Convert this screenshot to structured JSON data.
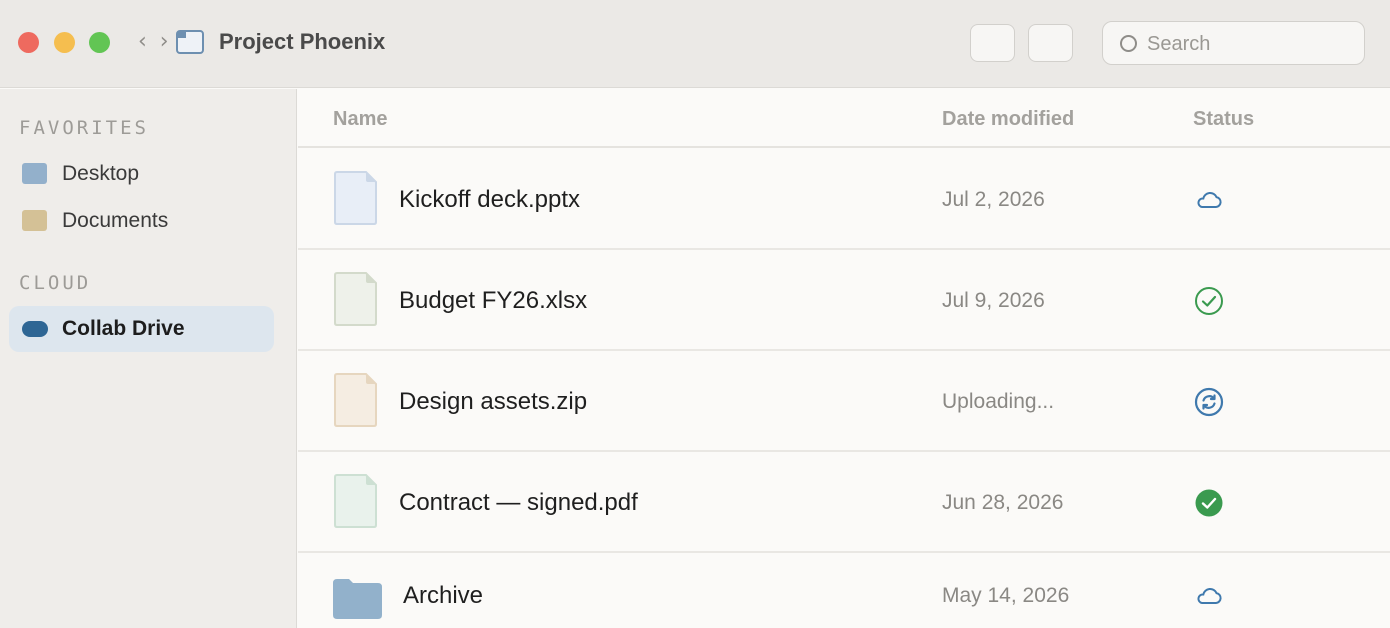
{
  "window": {
    "title": "Project Phoenix",
    "nav_arrows": "‹ ›"
  },
  "search": {
    "placeholder": "Search",
    "value": ""
  },
  "sidebar": {
    "sections": [
      {
        "title": "FAVORITES",
        "items": [
          {
            "label": "Desktop",
            "color": "#93b0cb",
            "active": false
          },
          {
            "label": "Documents",
            "color": "#d4c196",
            "active": false
          }
        ]
      },
      {
        "title": "CLOUD",
        "items": [
          {
            "label": "Collab Drive",
            "color": "#2e6694",
            "active": true
          }
        ]
      }
    ]
  },
  "columns": {
    "name": "Name",
    "date": "Date modified",
    "status": "Status"
  },
  "files": [
    {
      "name": "Kickoff deck.pptx",
      "date": "Jul 2, 2026",
      "status": "cloud-icon",
      "kind": "file",
      "fill": "#e8eef7",
      "stroke": "#cbd7e7"
    },
    {
      "name": "Budget FY26.xlsx",
      "date": "Jul 9, 2026",
      "status": "check-circle-outline-icon",
      "kind": "file",
      "fill": "#eef1ea",
      "stroke": "#d3dacb"
    },
    {
      "name": "Design assets.zip",
      "date": "Uploading...",
      "status": "sync-icon",
      "kind": "file",
      "fill": "#f5ede2",
      "stroke": "#e6d6bf"
    },
    {
      "name": "Contract — signed.pdf",
      "date": "Jun 28, 2026",
      "status": "check-circle-filled-icon",
      "kind": "file",
      "fill": "#e9f2ec",
      "stroke": "#cde0d3"
    },
    {
      "name": "Archive",
      "date": "May 14, 2026",
      "status": "cloud-icon",
      "kind": "folder",
      "fill": "#92b1cb",
      "stroke": "#92b1cb"
    }
  ],
  "colors": {
    "accent_blue": "#3f79ad",
    "success_green": "#3a9a4f",
    "sidebar_active": "#dde6ee"
  }
}
